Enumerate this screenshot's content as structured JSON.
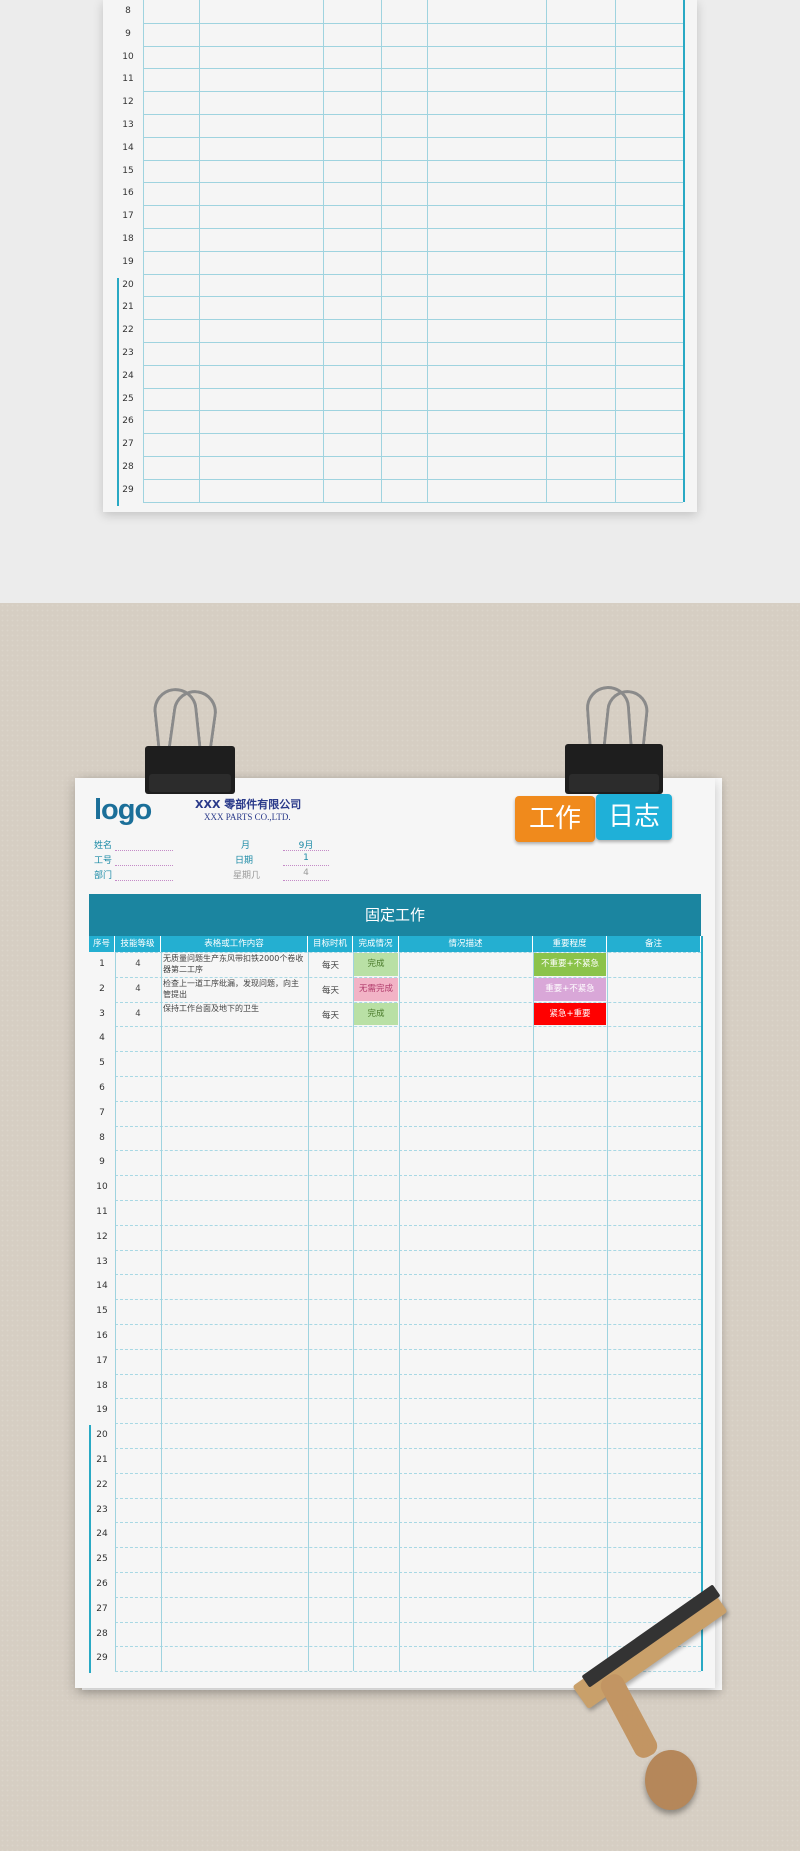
{
  "top_sheet": {
    "row_numbers": [
      "8",
      "9",
      "10",
      "11",
      "12",
      "13",
      "14",
      "15",
      "16",
      "17",
      "18",
      "19",
      "20",
      "21",
      "22",
      "23",
      "24",
      "25",
      "26",
      "27",
      "28",
      "29"
    ]
  },
  "sheet": {
    "logo": "logo",
    "company_cn": "XXX 零部件有限公司",
    "company_en": "XXX  PARTS CO.,LTD.",
    "badge_work": "工作",
    "badge_log": "日志",
    "info": {
      "name_label": "姓名",
      "id_label": "工号",
      "dept_label": "部门",
      "month_label": "月",
      "date_label": "日期",
      "weekday_label": "星期几",
      "month_value": "9月",
      "date_value": "1",
      "weekday_value": "4"
    },
    "banner_title": "固定工作",
    "headers": [
      "序号",
      "技能等级",
      "表格或工作内容",
      "目标时机",
      "完成情况",
      "情况描述",
      "重要程度",
      "备注"
    ],
    "rows": [
      {
        "no": "1",
        "level": "4",
        "content": "无质量问题生产东风带扣铁2000个卷收器第二工序",
        "timing": "每天",
        "status": "完成",
        "desc": "",
        "priority": "不重要+不紧急",
        "note": ""
      },
      {
        "no": "2",
        "level": "4",
        "content": "检查上一道工序纰漏，发现问题，向主管提出",
        "timing": "每天",
        "status": "无需完成",
        "desc": "",
        "priority": "重要+不紧急",
        "note": ""
      },
      {
        "no": "3",
        "level": "4",
        "content": "保持工作台面及地下的卫生",
        "timing": "每天",
        "status": "完成",
        "desc": "",
        "priority": "紧急+重要",
        "note": ""
      }
    ],
    "empty_row_numbers": [
      "4",
      "5",
      "6",
      "7",
      "8",
      "9",
      "10",
      "11",
      "12",
      "13",
      "14",
      "15",
      "16",
      "17",
      "18",
      "19",
      "20",
      "21",
      "22",
      "23",
      "24",
      "25",
      "26",
      "27",
      "28",
      "29"
    ]
  },
  "colors": {
    "banner": "#1b85a0",
    "header": "#24afd1",
    "badge_work": "#f08a1c",
    "badge_log": "#1fb0d8",
    "status_done": "#b9e0a5",
    "status_skip": "#f2b3c6",
    "priority_low": "#8bc34a",
    "priority_mid": "#d9a7d8",
    "priority_high": "#ff0000"
  }
}
